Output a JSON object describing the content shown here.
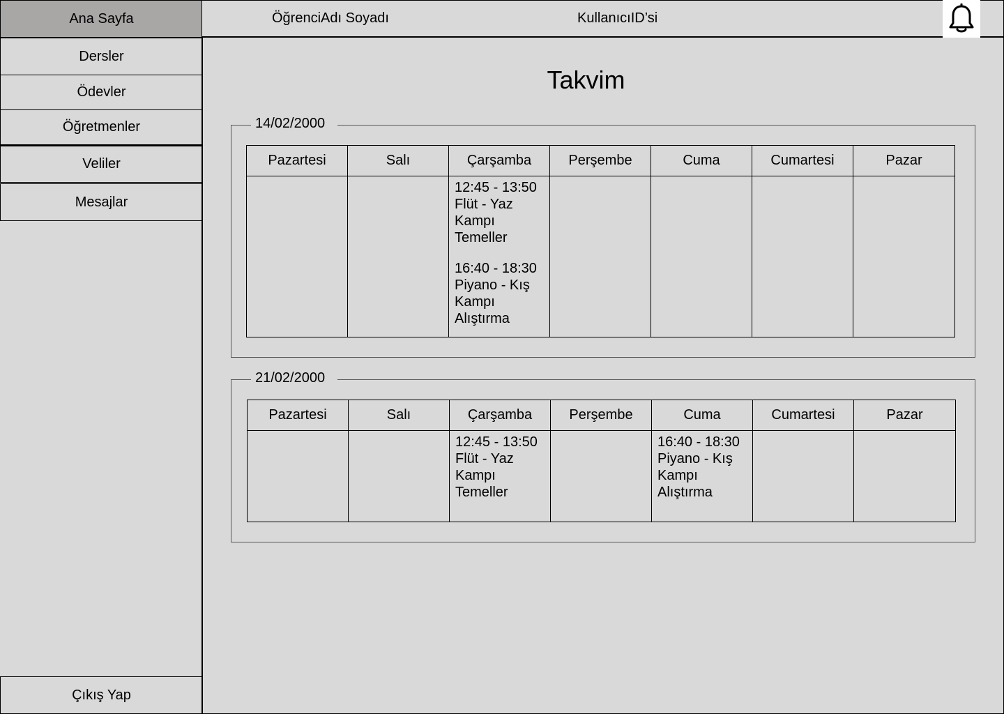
{
  "sidebar": {
    "home": "Ana Sayfa",
    "items": [
      {
        "label": "Dersler"
      },
      {
        "label": "Ödevler"
      },
      {
        "label": "Öğretmenler"
      },
      {
        "label": "Veliler"
      },
      {
        "label": "Mesajlar"
      }
    ],
    "logout": "Çıkış Yap"
  },
  "header": {
    "student_name": "ÖğrenciAdı Soyadı",
    "user_id": "KullanıcıID’si",
    "notification_icon": "bell-icon"
  },
  "page": {
    "title": "Takvim"
  },
  "weeks": [
    {
      "date": "14/02/2000",
      "days": [
        "Pazartesi",
        "Salı",
        "Çarşamba",
        "Perşembe",
        "Cuma",
        "Cumartesi",
        "Pazar"
      ],
      "events": [
        [],
        [],
        [
          {
            "time": "12:45 - 13:50",
            "text": "Flüt - Yaz\nKampı\nTemeller"
          },
          {
            "time": "16:40 - 18:30",
            "text": "Piyano  - Kış\nKampı\nAlıştırma"
          }
        ],
        [],
        [],
        [],
        []
      ]
    },
    {
      "date": "21/02/2000",
      "days": [
        "Pazartesi",
        "Salı",
        "Çarşamba",
        "Perşembe",
        "Cuma",
        "Cumartesi",
        "Pazar"
      ],
      "events": [
        [],
        [],
        [
          {
            "time": "12:45 - 13:50",
            "text": "Flüt - Yaz\nKampı\nTemeller"
          }
        ],
        [],
        [
          {
            "time": "16:40 - 18:30",
            "text": "Piyano  - Kış\nKampı\nAlıştırma"
          }
        ],
        [],
        []
      ]
    }
  ]
}
